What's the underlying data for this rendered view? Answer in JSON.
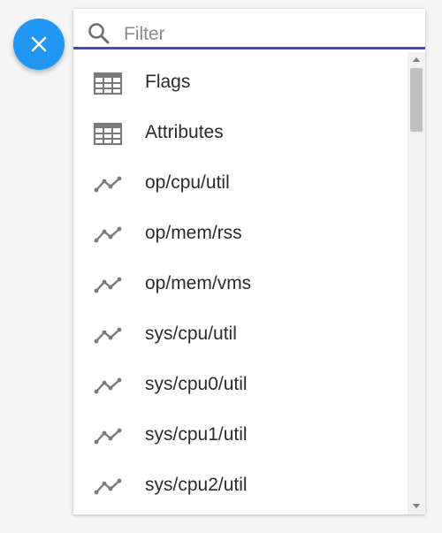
{
  "fab": {
    "icon": "close-icon",
    "color": "#2196f3"
  },
  "filter": {
    "placeholder": "Filter",
    "value": "",
    "icon": "search-icon",
    "underline_color": "#3f51b5"
  },
  "items": [
    {
      "label": "Flags",
      "icon": "table-icon"
    },
    {
      "label": "Attributes",
      "icon": "table-icon"
    },
    {
      "label": "op/cpu/util",
      "icon": "line-chart-icon"
    },
    {
      "label": "op/mem/rss",
      "icon": "line-chart-icon"
    },
    {
      "label": "op/mem/vms",
      "icon": "line-chart-icon"
    },
    {
      "label": "sys/cpu/util",
      "icon": "line-chart-icon"
    },
    {
      "label": "sys/cpu0/util",
      "icon": "line-chart-icon"
    },
    {
      "label": "sys/cpu1/util",
      "icon": "line-chart-icon"
    },
    {
      "label": "sys/cpu2/util",
      "icon": "line-chart-icon"
    }
  ]
}
